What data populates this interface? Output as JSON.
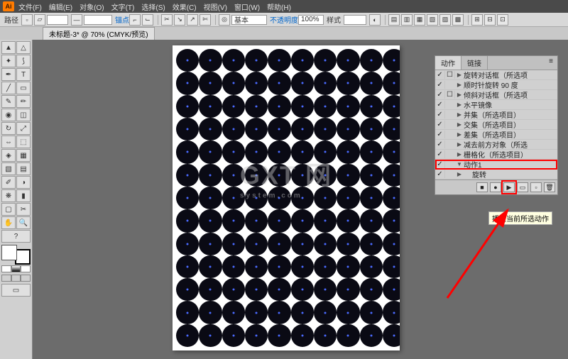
{
  "menubar": {
    "logo": "Ai",
    "items": [
      "文件(F)",
      "编辑(E)",
      "对象(O)",
      "文字(T)",
      "选择(S)",
      "效果(C)",
      "视图(V)",
      "窗口(W)",
      "帮助(H)"
    ]
  },
  "toolbar": {
    "path_label": "路径",
    "anchor_label": "锚点",
    "basic_label": "基本",
    "opacity_label": "不透明度",
    "opacity_value": "100%",
    "style_label": "样式"
  },
  "document_tab": "未标题-3* @ 70% (CMYK/预览)",
  "swatch_fill": "#ffffff",
  "actions_panel": {
    "tab_actions": "动作",
    "tab_links": "链接",
    "rows": [
      {
        "chk": "✓",
        "box": "☐",
        "arrow": "▶",
        "label": "旋转对话框（所选项"
      },
      {
        "chk": "✓",
        "box": "",
        "arrow": "▶",
        "label": "顺时针旋转 90 度"
      },
      {
        "chk": "✓",
        "box": "☐",
        "arrow": "▶",
        "label": "倾斜对话框（所选项"
      },
      {
        "chk": "✓",
        "box": "",
        "arrow": "▶",
        "label": "水平镜像"
      },
      {
        "chk": "✓",
        "box": "",
        "arrow": "▶",
        "label": "并集（所选项目）"
      },
      {
        "chk": "✓",
        "box": "",
        "arrow": "▶",
        "label": "交集（所选项目）"
      },
      {
        "chk": "✓",
        "box": "",
        "arrow": "▶",
        "label": "差集（所选项目）"
      },
      {
        "chk": "✓",
        "box": "",
        "arrow": "▶",
        "label": "减去前方对象（所选"
      },
      {
        "chk": "✓",
        "box": "",
        "arrow": "▶",
        "label": "栅格化（所选项目）"
      },
      {
        "chk": "✓",
        "box": "",
        "arrow": "▼",
        "label": "动作1",
        "hl": true
      },
      {
        "chk": "✓",
        "box": "",
        "arrow": "▶",
        "label": "旋转",
        "indent": true
      }
    ],
    "buttons": {
      "stop": "■",
      "record": "●",
      "play": "▶",
      "folder": "▭",
      "new": "▫",
      "delete": "🗑"
    }
  },
  "tooltip": "播放当前所选动作",
  "watermark": {
    "main": "GXT 网",
    "sub": "system.com"
  }
}
